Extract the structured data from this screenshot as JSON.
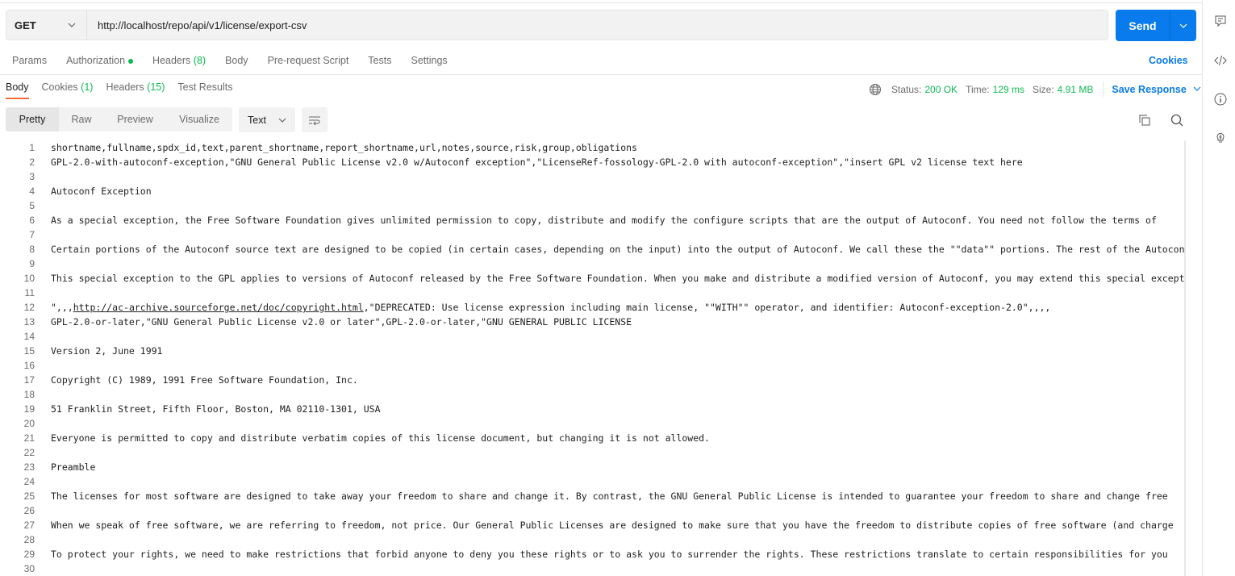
{
  "request": {
    "method": "GET",
    "url": "http://localhost/repo/api/v1/license/export-csv",
    "send_label": "Send"
  },
  "req_tabs": [
    {
      "label": "Params"
    },
    {
      "label": "Authorization",
      "dot": true
    },
    {
      "label": "Headers",
      "count": "(8)"
    },
    {
      "label": "Body"
    },
    {
      "label": "Pre-request Script"
    },
    {
      "label": "Tests"
    },
    {
      "label": "Settings"
    }
  ],
  "cookies_link": "Cookies",
  "res_tabs": [
    {
      "label": "Body",
      "active": true
    },
    {
      "label": "Cookies",
      "count": "(1)"
    },
    {
      "label": "Headers",
      "count": "(15)"
    },
    {
      "label": "Test Results"
    }
  ],
  "status": {
    "status_label": "Status:",
    "status_value": "200 OK",
    "time_label": "Time:",
    "time_value": "129 ms",
    "size_label": "Size:",
    "size_value": "4.91 MB",
    "save_label": "Save Response"
  },
  "view_modes": [
    "Pretty",
    "Raw",
    "Preview",
    "Visualize"
  ],
  "format": "Text",
  "colors": {
    "accent": "#097bed",
    "success": "#0cbb52",
    "active_tab": "#f26b3a"
  },
  "lines": [
    "shortname,fullname,spdx_id,text,parent_shortname,report_shortname,url,notes,source,risk,group,obligations",
    "GPL-2.0-with-autoconf-exception,\"GNU General Public License v2.0 w/Autoconf exception\",\"LicenseRef-fossology-GPL-2.0 with autoconf-exception\",\"insert GPL v2 license text here",
    "",
    "Autoconf Exception",
    "",
    "As a special exception, the Free Software Foundation gives unlimited permission to copy, distribute and modify the configure scripts that are the output of Autoconf. You need not follow the terms of",
    "",
    "Certain portions of the Autoconf source text are designed to be copied (in certain cases, depending on the input) into the output of Autoconf. We call these the \"\"data\"\" portions. The rest of the Autoconf",
    "",
    "This special exception to the GPL applies to versions of Autoconf released by the Free Software Foundation. When you make and distribute a modified version of Autoconf, you may extend this special exception",
    "",
    "\",,,http://ac-archive.sourceforge.net/doc/copyright.html,\"DEPRECATED: Use license expression including main license, \"\"WITH\"\" operator, and identifier: Autoconf-exception-2.0\",,,,",
    "GPL-2.0-or-later,\"GNU General Public License v2.0 or later\",GPL-2.0-or-later,\"GNU GENERAL PUBLIC LICENSE",
    "",
    "Version 2, June 1991",
    "",
    "Copyright (C) 1989, 1991 Free Software Foundation, Inc.",
    "",
    "51 Franklin Street, Fifth Floor, Boston, MA 02110-1301, USA",
    "",
    "Everyone is permitted to copy and distribute verbatim copies of this license document, but changing it is not allowed.",
    "",
    "Preamble",
    "",
    "The licenses for most software are designed to take away your freedom to share and change it. By contrast, the GNU General Public License is intended to guarantee your freedom to share and change free",
    "",
    "When we speak of free software, we are referring to freedom, not price. Our General Public Licenses are designed to make sure that you have the freedom to distribute copies of free software (and charge",
    "",
    "To protect your rights, we need to make restrictions that forbid anyone to deny you these rights or to ask you to surrender the rights. These restrictions translate to certain responsibilities for you",
    ""
  ],
  "link_in_line_12": "http://ac-archive.sourceforge.net/doc/copyright.html"
}
